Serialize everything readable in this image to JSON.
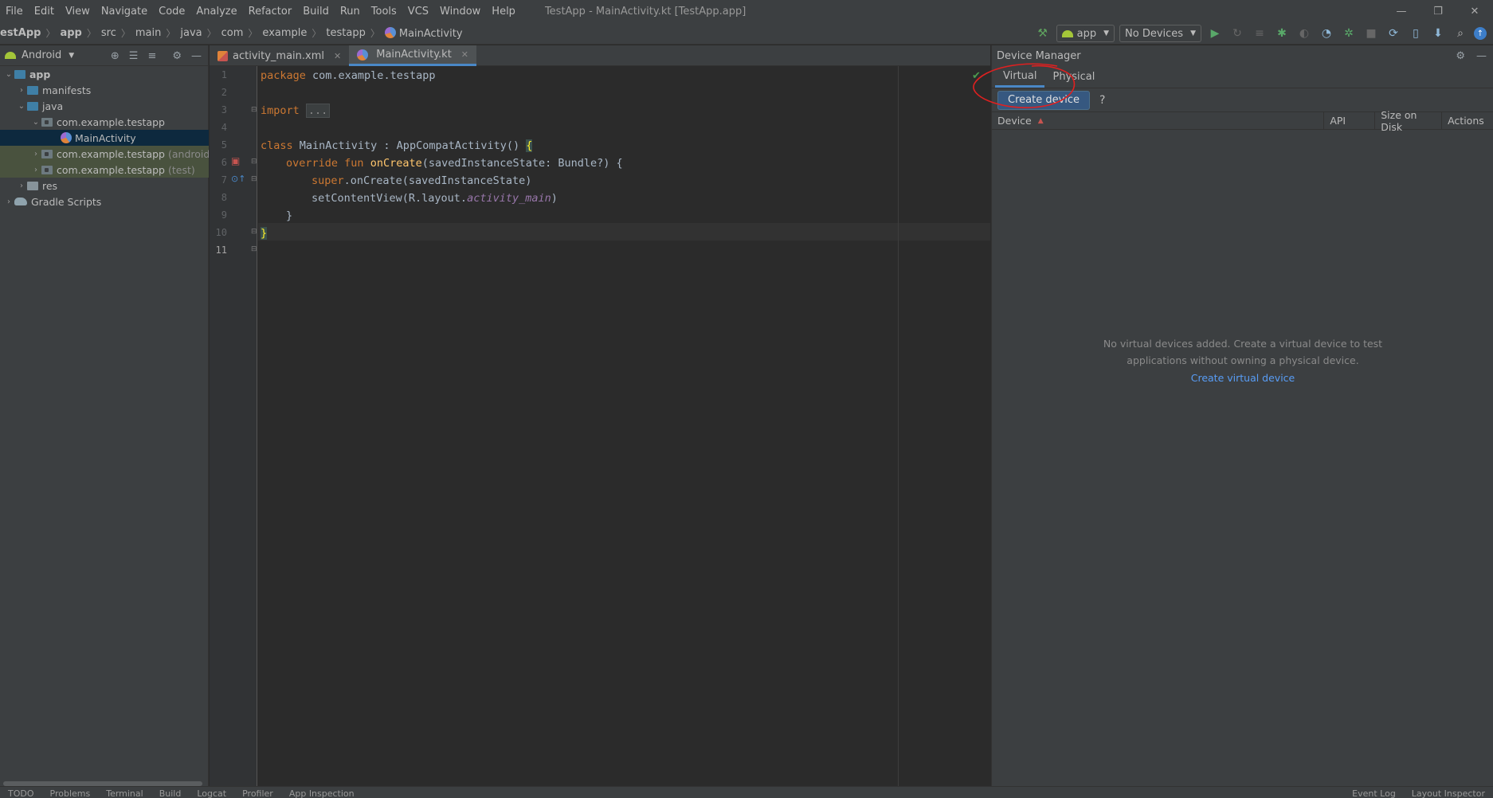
{
  "menu": {
    "items": [
      "File",
      "Edit",
      "View",
      "Navigate",
      "Code",
      "Analyze",
      "Refactor",
      "Build",
      "Run",
      "Tools",
      "VCS",
      "Window",
      "Help"
    ],
    "window_title": "TestApp - MainActivity.kt [TestApp.app]"
  },
  "window_controls": {
    "minimize": "—",
    "restore": "❐",
    "close": "✕"
  },
  "breadcrumb": [
    "estApp",
    "app",
    "src",
    "main",
    "java",
    "com",
    "example",
    "testapp",
    "MainActivity"
  ],
  "toolbar": {
    "run_config": "app",
    "device_selector": "No Devices"
  },
  "project": {
    "view": "Android",
    "tree": [
      {
        "label": "app",
        "level": 0,
        "expanded": true,
        "kind": "module",
        "bold": true
      },
      {
        "label": "manifests",
        "level": 1,
        "expanded": false,
        "kind": "folder-blue"
      },
      {
        "label": "java",
        "level": 1,
        "expanded": true,
        "kind": "folder-blue"
      },
      {
        "label": "com.example.testapp",
        "level": 2,
        "expanded": true,
        "kind": "package"
      },
      {
        "label": "MainActivity",
        "level": 3,
        "kind": "kotlin",
        "selected": true
      },
      {
        "label": "com.example.testapp",
        "suffix": "(androidTest)",
        "level": 2,
        "expanded": false,
        "kind": "package",
        "tinted": true
      },
      {
        "label": "com.example.testapp",
        "suffix": "(test)",
        "level": 2,
        "expanded": false,
        "kind": "package",
        "tinted": true
      },
      {
        "label": "res",
        "level": 1,
        "expanded": false,
        "kind": "folder"
      },
      {
        "label": "Gradle Scripts",
        "level": 0,
        "expanded": false,
        "kind": "gradle"
      }
    ]
  },
  "editor": {
    "tabs": [
      {
        "label": "activity_main.xml",
        "active": false
      },
      {
        "label": "MainActivity.kt",
        "active": true
      }
    ],
    "line_numbers": [
      "1",
      "2",
      "3",
      "4",
      "5",
      "6",
      "7",
      "8",
      "9",
      "10",
      "11"
    ],
    "code": {
      "l1_kw": "package",
      "l1_rest": " com.example.testapp",
      "l3_kw": "import",
      "l3_fold": "...",
      "l6_kw": "class",
      "l6_rest": " MainActivity : AppCompatActivity() ",
      "l6_brace": "{",
      "l7_kw": "override fun",
      "l7_fn": "onCreate",
      "l7_rest": "(savedInstanceState: Bundle?) {",
      "l8_kw": "super",
      "l8_rest": ".onCreate(savedInstanceState)",
      "l9_pre": "setContentView(R.layout.",
      "l9_it": "activity_main",
      "l9_post": ")",
      "l10": "}",
      "l11": "}"
    }
  },
  "device_manager": {
    "title": "Device Manager",
    "tabs": [
      "Virtual",
      "Physical"
    ],
    "create_button": "Create device",
    "help": "?",
    "columns": [
      "Device",
      "API",
      "Size on Disk",
      "Actions"
    ],
    "empty_line1": "No virtual devices added. Create a virtual device to test",
    "empty_line2": "applications without owning a physical device.",
    "create_link": "Create virtual device"
  },
  "bottom_tools": {
    "left": [
      "TODO",
      "Problems",
      "Terminal",
      "Build",
      "Logcat",
      "Profiler",
      "App Inspection"
    ],
    "right": [
      "Event Log",
      "Layout Inspector"
    ]
  },
  "colors": {
    "accent": "#4a88c7",
    "annotation": "#e02020",
    "link": "#589df6"
  }
}
